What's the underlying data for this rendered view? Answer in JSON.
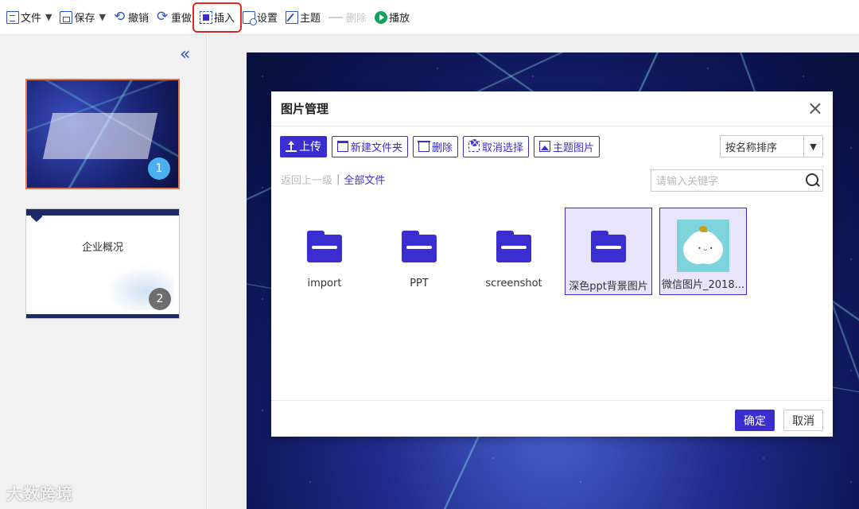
{
  "toolbar": {
    "file": "文件",
    "save": "保存",
    "undo": "撤销",
    "redo": "重做",
    "insert": "插入",
    "settings": "设置",
    "theme": "主题",
    "delete": "删除",
    "play": "播放",
    "caret": "▼",
    "highlight_color": "#e3261e"
  },
  "sidebar": {
    "collapse_icon": "«",
    "slides": [
      {
        "number": "1",
        "title": ""
      },
      {
        "number": "2",
        "title": "企业概况"
      }
    ]
  },
  "watermark": "大数跨境",
  "dialog": {
    "title": "图片管理",
    "close": "×",
    "buttons": {
      "upload": "上传",
      "new_folder": "新建文件夹",
      "delete": "删除",
      "cancel_select": "取消选择",
      "theme_images": "主题图片"
    },
    "sort": {
      "value": "按名称排序",
      "arrow": "▼"
    },
    "path": {
      "back": "返回上一级",
      "separator": "|",
      "all_files": "全部文件"
    },
    "search": {
      "placeholder": "请输入关键字",
      "value": ""
    },
    "files": [
      {
        "name": "import",
        "type": "folder",
        "selected": false
      },
      {
        "name": "PPT",
        "type": "folder",
        "selected": false
      },
      {
        "name": "screenshot",
        "type": "folder",
        "selected": false
      },
      {
        "name": "深色ppt背景图片",
        "type": "folder",
        "selected": true
      },
      {
        "name": "微信图片_2018...",
        "type": "image",
        "selected": true
      }
    ],
    "footer": {
      "ok": "确定",
      "cancel": "取消"
    }
  },
  "colors": {
    "accent": "#3b2ed1",
    "selected_bg": "#e7e4fb",
    "play_green": "#17a05d",
    "thumb_border": "#e0744a"
  }
}
